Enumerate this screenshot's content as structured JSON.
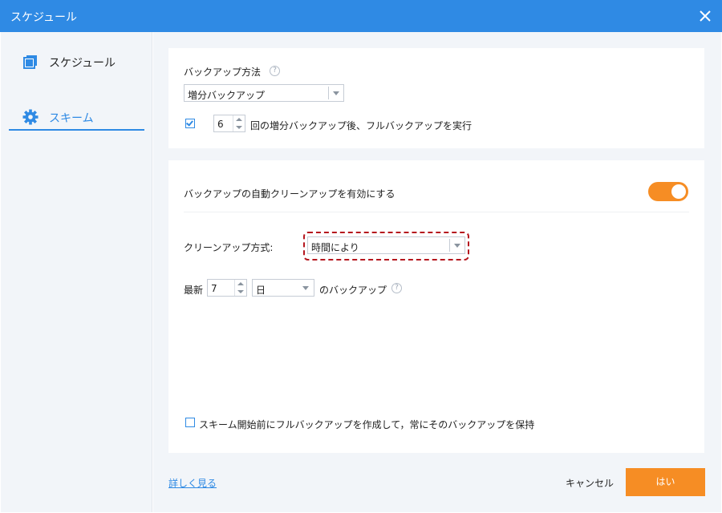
{
  "window": {
    "title": "スケジュール"
  },
  "sidebar": {
    "items": [
      {
        "label": "スケジュール",
        "icon": "copy-icon",
        "active": false
      },
      {
        "label": "スキーム",
        "icon": "gear-icon",
        "active": true
      }
    ]
  },
  "backup": {
    "method_label": "バックアップ方法",
    "method_value": "増分バックアップ",
    "full_every_checked": true,
    "full_every_count": "6",
    "full_every_text": "回の増分バックアップ後、フルバックアップを実行"
  },
  "cleanup": {
    "auto_label": "バックアップの自動クリーンアップを有効にする",
    "auto_enabled": true,
    "method_label": "クリーンアップ方式:",
    "method_value": "時間により",
    "latest_label": "最新",
    "latest_count": "7",
    "unit_value": "日",
    "suffix_text": "のバックアップ",
    "keep_full_checked": false,
    "keep_full_text": "スキーム開始前にフルバックアップを作成して，常にそのバックアップを保持"
  },
  "footer": {
    "more_link": "詳しく見る",
    "cancel_label": "キャンセル",
    "ok_label": "はい"
  },
  "colors": {
    "accent": "#2f8ae4",
    "primary_button": "#f68d24",
    "highlight": "#b5161e"
  }
}
